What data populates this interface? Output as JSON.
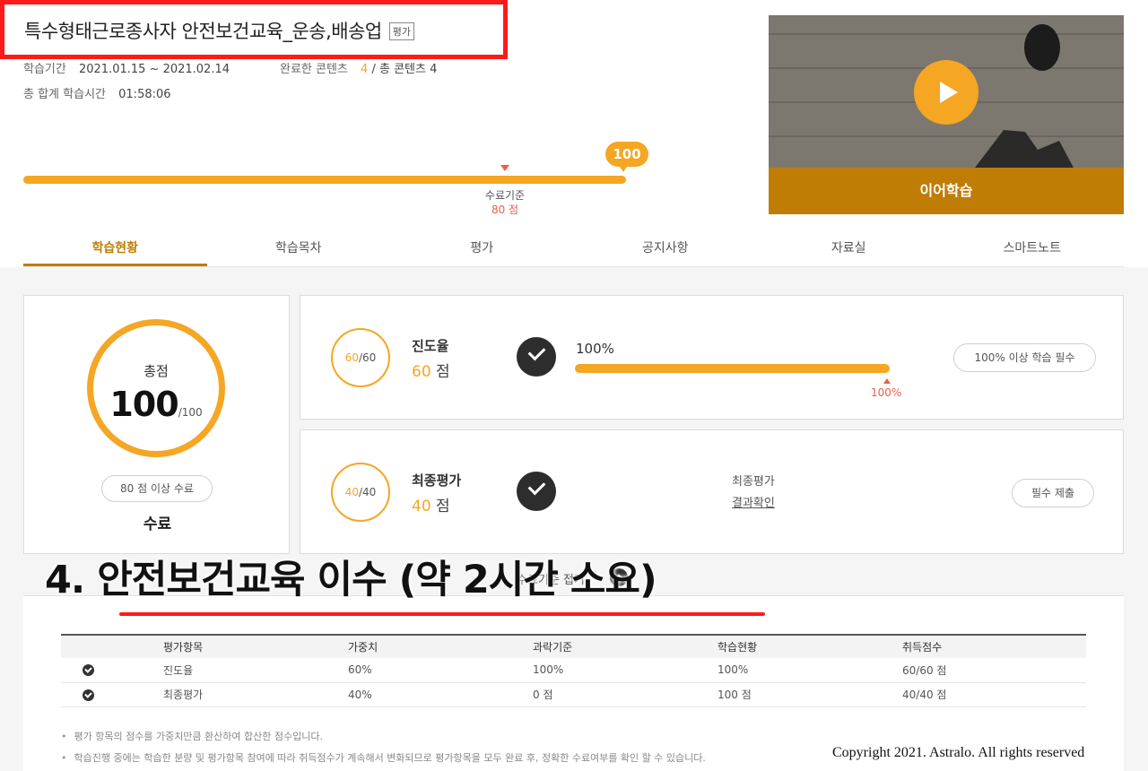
{
  "course": {
    "title": "특수형태근로종사자 안전보건교육_운송,배송업",
    "badge": "평가",
    "period_label": "학습기간",
    "period_value": "2021.01.15 ~ 2021.02.14",
    "completed_label": "완료한 콘텐츠",
    "completed_value": "4",
    "total_contents": "/ 총 콘텐츠 4",
    "study_time_label": "총 합계 학습시간",
    "study_time_value": "01:58:06"
  },
  "progress": {
    "value": 100,
    "bubble": "100",
    "cutoff_label": "수료기준",
    "cutoff_score": "80 점"
  },
  "video": {
    "play_icon": "play-icon",
    "resume_label": "이어학습"
  },
  "tabs": [
    {
      "label": "학습현황",
      "active": true
    },
    {
      "label": "학습목차"
    },
    {
      "label": "평가"
    },
    {
      "label": "공지사항"
    },
    {
      "label": "자료실"
    },
    {
      "label": "스마트노트"
    }
  ],
  "total": {
    "label": "총점",
    "score": "100",
    "max": "/100",
    "pass_criteria": "80 점 이상 수료",
    "status": "수료"
  },
  "progress_item": {
    "ring_score": "60",
    "ring_max": "/60",
    "title": "진도율",
    "score_num": "60",
    "score_unit": "점",
    "percent": "100%",
    "fill": 1.0,
    "marker_label": "100%",
    "requirement": "100% 이상 학습 필수"
  },
  "final_item": {
    "ring_score": "40",
    "ring_max": "/40",
    "title": "최종평가",
    "score_num": "40",
    "score_unit": "점",
    "result_label": "최종평가",
    "result_link": "결과확인",
    "submit_label": "필수 제출"
  },
  "toggle": {
    "label": "수료기준 접기",
    "icon": "chevron-up-icon"
  },
  "table": {
    "headers": [
      "",
      "평가항목",
      "가중치",
      "과락기준",
      "학습현황",
      "취득점수"
    ],
    "rows": [
      [
        "",
        "진도율",
        "60%",
        "100%",
        "100%",
        "60/60 점"
      ],
      [
        "",
        "최종평가",
        "40%",
        "0 점",
        "100 점",
        "40/40 점"
      ]
    ]
  },
  "notes": [
    "평가 항목의 점수를 가중치만큼 환산하여 합산한 점수입니다.",
    "학습진행 중에는 학습한 분량 및 평가항목 참여에 따라 취득점수가 계속해서 변화되므로 평가항목을 모두 완료 후, 정확한 수료여부를 확인 할 수 있습니다."
  ],
  "overlay": {
    "caption": "4. 안전보건교육 이수 (약 2시간 소요)",
    "copyright": "Copyright 2021. Astralo. All rights reserved"
  },
  "colors": {
    "accent": "#f5a623",
    "accent_dark": "#c07d06",
    "highlight_red": "#ff1a1a",
    "marker_red": "#e8604a"
  }
}
